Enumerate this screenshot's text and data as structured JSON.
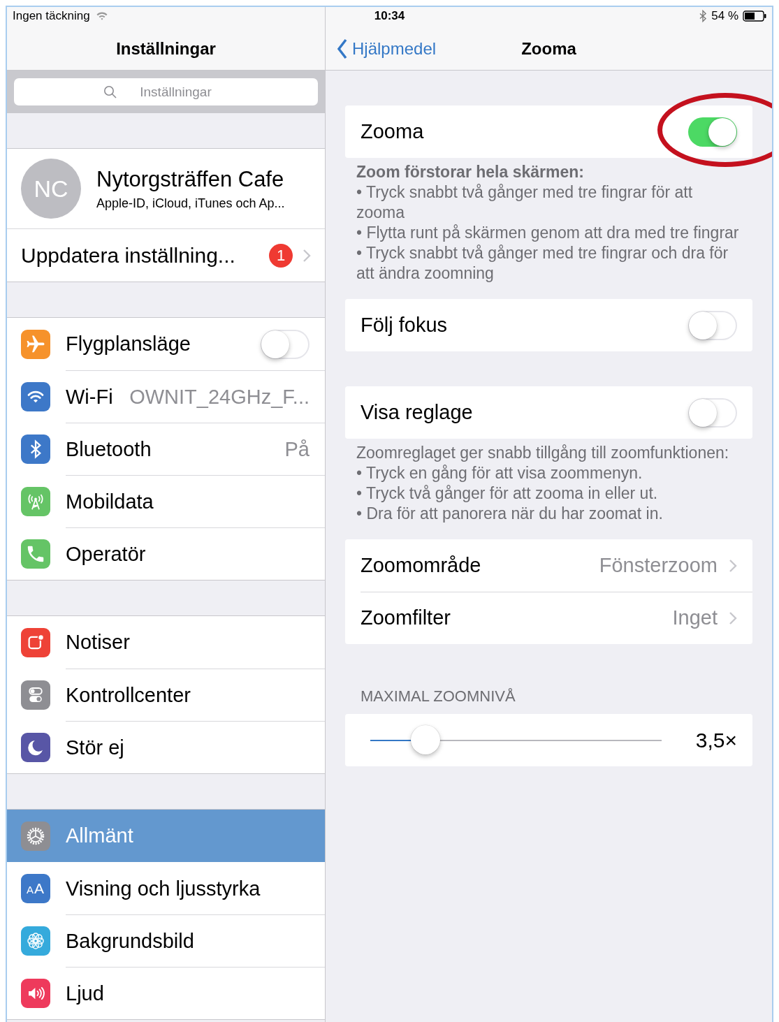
{
  "status_bar": {
    "carrier": "Ingen täckning",
    "time": "10:34",
    "battery": "54 %"
  },
  "sidebar": {
    "title": "Inställningar",
    "search": {
      "placeholder": "Inställningar"
    },
    "profile": {
      "initials": "NC",
      "name": "Nytorgsträffen Cafe",
      "subtitle": "Apple-ID, iCloud, iTunes och Ap..."
    },
    "update": {
      "label": "Uppdatera inställning...",
      "badge": "1"
    },
    "groups": [
      [
        {
          "label": "Flygplansläge",
          "kind": "toggle",
          "on": false,
          "selected": false
        },
        {
          "label": "Wi-Fi",
          "kind": "value",
          "value": "OWNIT_24GHz_F...",
          "selected": false
        },
        {
          "label": "Bluetooth",
          "kind": "value",
          "value": "På",
          "selected": false
        },
        {
          "label": "Mobildata",
          "kind": "plain",
          "selected": false
        },
        {
          "label": "Operatör",
          "kind": "plain",
          "selected": false
        }
      ],
      [
        {
          "label": "Notiser",
          "kind": "plain",
          "selected": false
        },
        {
          "label": "Kontrollcenter",
          "kind": "plain",
          "selected": false
        },
        {
          "label": "Stör ej",
          "kind": "plain",
          "selected": false
        }
      ],
      [
        {
          "label": "Allmänt",
          "kind": "plain",
          "selected": true
        },
        {
          "icon_text": "AA",
          "label": "Visning och ljusstyrka",
          "kind": "plain",
          "selected": false
        },
        {
          "label": "Bakgrundsbild",
          "kind": "plain",
          "selected": false
        },
        {
          "label": "Ljud",
          "kind": "plain",
          "selected": false
        }
      ]
    ]
  },
  "detail": {
    "back": "Hjälpmedel",
    "title": "Zooma",
    "sections": [
      {
        "rows": [
          {
            "kind": "toggle",
            "label": "Zooma",
            "on": true,
            "circled": true
          }
        ],
        "footer": {
          "heading": "Zoom förstorar hela skärmen:",
          "lines": [
            "• Tryck snabbt två gånger med tre fingrar för att zooma",
            "• Flytta runt på skärmen genom att dra med tre fingrar",
            "• Tryck snabbt två gånger med tre fingrar och dra för att ändra zoomning"
          ]
        }
      },
      {
        "rows": [
          {
            "kind": "toggle",
            "label": "Följ fokus",
            "on": false
          }
        ]
      },
      {
        "rows": [
          {
            "kind": "toggle",
            "label": "Visa reglage",
            "on": false
          }
        ],
        "footer": {
          "lines": [
            "Zoomreglaget ger snabb tillgång till zoomfunktionen:",
            "• Tryck en gång för att visa zoommenyn.",
            "• Tryck två gånger för att zooma in eller ut.",
            "• Dra för att panorera när du har zoomat in."
          ]
        }
      },
      {
        "rows": [
          {
            "kind": "link",
            "label": "Zoomområde",
            "value": "Fönsterzoom"
          },
          {
            "kind": "link",
            "label": "Zoomfilter",
            "value": "Inget"
          }
        ]
      },
      {
        "header": "MAXIMAL ZOOMNIVÅ",
        "rows": [
          {
            "kind": "slider",
            "level": 0.19,
            "reading": "3,5×"
          }
        ]
      }
    ]
  }
}
